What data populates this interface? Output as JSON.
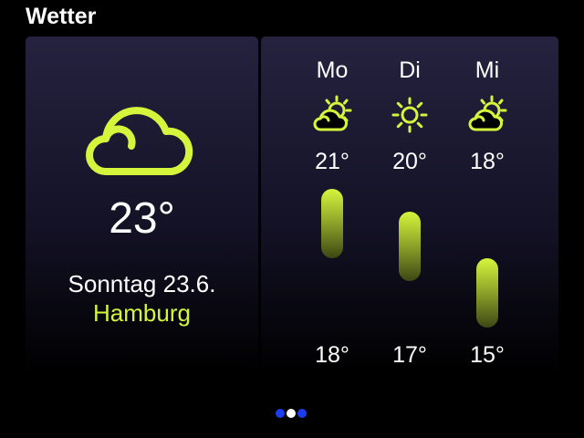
{
  "app": {
    "title": "Wetter"
  },
  "colors": {
    "accent": "#d4f53c",
    "background": "#000000",
    "page_dot": "#1c3cf0",
    "page_dot_active": "#ffffff"
  },
  "current": {
    "icon": "cloud-icon",
    "temperature": "23°",
    "date": "Sonntag 23.6.",
    "city": "Hamburg"
  },
  "forecast": [
    {
      "day": "Mo",
      "icon": "partly-cloudy-icon",
      "high": "21°",
      "low": "18°"
    },
    {
      "day": "Di",
      "icon": "sun-icon",
      "high": "20°",
      "low": "17°"
    },
    {
      "day": "Mi",
      "icon": "partly-cloudy-icon",
      "high": "18°",
      "low": "15°"
    }
  ],
  "pagination": {
    "pages": 3,
    "active_index": 1
  }
}
